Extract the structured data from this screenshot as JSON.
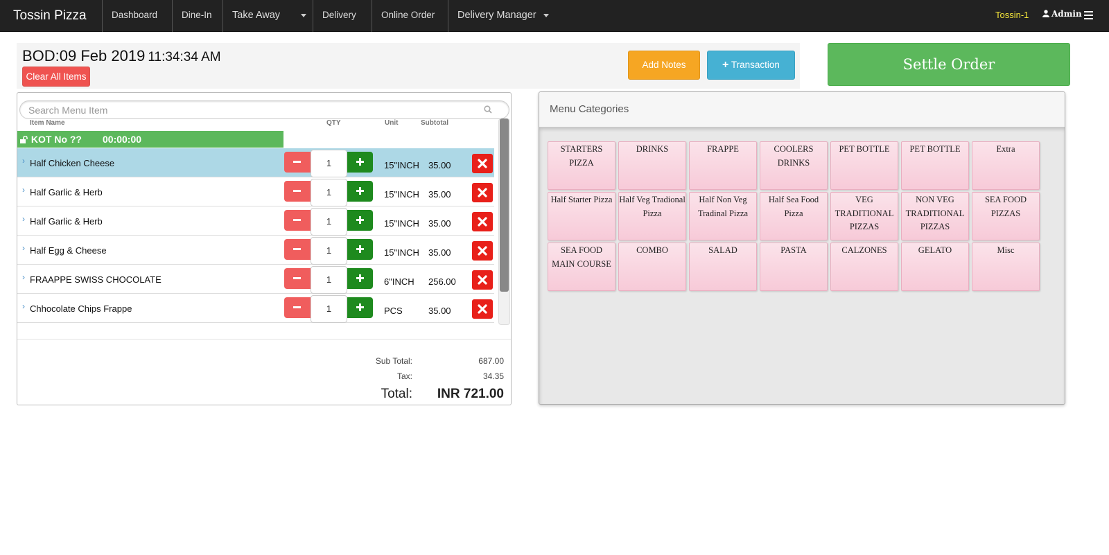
{
  "nav": {
    "brand": "Tossin Pizza",
    "items": [
      {
        "label": "Dashboard",
        "dropdown": false
      },
      {
        "label": "Dine-In",
        "dropdown": false
      },
      {
        "label": "Take Away",
        "dropdown": true
      },
      {
        "label": "Delivery",
        "dropdown": false
      },
      {
        "label": "Online Order",
        "dropdown": false
      },
      {
        "label": "Delivery Manager",
        "dropdown": true
      }
    ],
    "store": "Tossin-1",
    "user": "Admin"
  },
  "header": {
    "bod": "BOD:09 Feb 2019",
    "time": "11:34:34 AM",
    "clear_label": "Clear All Items",
    "notes_label": "Add Notes",
    "transaction_label": "Transaction",
    "settle_label": "Settle Order"
  },
  "order": {
    "search_placeholder": "Search Menu Item",
    "columns": {
      "item": "Item Name",
      "qty": "QTY",
      "unit": "Unit",
      "subtotal": "Subtotal"
    },
    "kot_label": "KOT No ??",
    "kot_timer": "00:00:00",
    "items": [
      {
        "name": "Half Chicken Cheese",
        "qty": "1",
        "unit": "15\"INCH",
        "subtotal": "35.00",
        "selected": true
      },
      {
        "name": "Half Garlic & Herb",
        "qty": "1",
        "unit": "15\"INCH",
        "subtotal": "35.00",
        "selected": false
      },
      {
        "name": "Half Garlic & Herb",
        "qty": "1",
        "unit": "15\"INCH",
        "subtotal": "35.00",
        "selected": false
      },
      {
        "name": "Half Egg & Cheese",
        "qty": "1",
        "unit": "15\"INCH",
        "subtotal": "35.00",
        "selected": false
      },
      {
        "name": "FRAAPPE SWISS CHOCOLATE",
        "qty": "1",
        "unit": "6\"INCH",
        "subtotal": "256.00",
        "selected": false
      },
      {
        "name": "Chhocolate Chips Frappe",
        "qty": "1",
        "unit": "PCS",
        "subtotal": "35.00",
        "selected": false
      }
    ],
    "totals": {
      "sub_total_label": "Sub Total:",
      "sub_total": "687.00",
      "tax_label": "Tax:",
      "tax": "34.35",
      "total_label": "Total:",
      "total": "INR 721.00"
    }
  },
  "menu": {
    "title": "Menu Categories",
    "categories": [
      "STARTERS PIZZA",
      "DRINKS",
      "FRAPPE",
      "COOLERS DRINKS",
      "PET BOTTLE",
      "PET BOTTLE",
      "Extra",
      "Half Starter Pizza",
      "Half Veg Tradional Pizza",
      "Half Non Veg Tradinal Pizza",
      "Half Sea Food Pizza",
      "VEG TRADITIONAL PIZZAS",
      "NON VEG TRADITIONAL PIZZAS",
      "SEA FOOD PIZZAS",
      "SEA FOOD MAIN COURSE",
      "COMBO",
      "SALAD",
      "PASTA",
      "CALZONES",
      "GELATO",
      "Misc"
    ]
  },
  "colors": {
    "navbar": "#222222",
    "kot_green": "#5cb85c",
    "settle_green": "#5cb85c",
    "notes_orange": "#f6a623",
    "transaction_blue": "#46b1d3",
    "delete_red": "#e8201a",
    "tile_pink": "#f7cad8",
    "store_yellow": "#f5e63a"
  }
}
